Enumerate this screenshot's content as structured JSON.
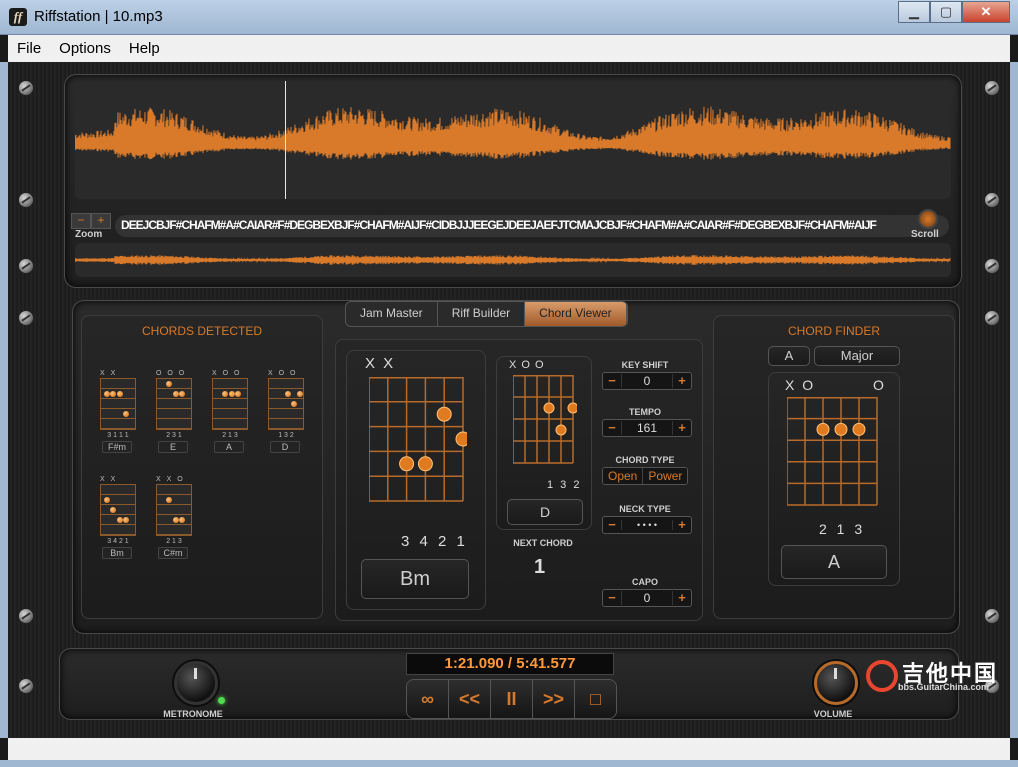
{
  "window": {
    "title": "Riffstation | 10.mp3",
    "app_icon": "ff"
  },
  "menu": [
    "File",
    "Options",
    "Help"
  ],
  "waveform": {
    "chord_sequence_text": "DEEJCBJF#CHAFM#A#CAIAR#F#DEGBEXBJF#CHAFM#AIJF#CIDBJJJEEGEJDEEJAEFJTCMAJCBJF#CHAFM#A#CAIAR#F#DEGBEXBJF#CHAFM#AIJF",
    "zoom_label": "Zoom",
    "zoom_minus": "−",
    "zoom_plus": "+",
    "scroll_label": "Scroll"
  },
  "tabs": [
    "Jam Master",
    "Riff Builder",
    "Chord Viewer"
  ],
  "active_tab": "Chord Viewer",
  "chords_detected": {
    "title": "CHORDS DETECTED",
    "items": [
      {
        "name": "F#m",
        "marks": "X X",
        "fingers": "3 1 1 1"
      },
      {
        "name": "E",
        "marks": "O    O O",
        "fingers": "2 3 1"
      },
      {
        "name": "A",
        "marks": "X O    O",
        "fingers": "2 1 3"
      },
      {
        "name": "D",
        "marks": "X O O",
        "fingers": "1 3 2"
      },
      {
        "name": "Bm",
        "marks": "X X",
        "fingers": "3 4 2 1"
      },
      {
        "name": "C#m",
        "marks": "X X    O",
        "fingers": "2 1 3"
      }
    ]
  },
  "current_chord": {
    "name": "Bm",
    "marks": "X X",
    "fingers": "3 4 2 1"
  },
  "next_chord": {
    "name": "D",
    "marks": "X O O",
    "fingers": "1 3 2",
    "label": "NEXT CHORD",
    "count": "1"
  },
  "controls": {
    "key_shift_label": "KEY SHIFT",
    "key_shift_value": "0",
    "tempo_label": "TEMPO",
    "tempo_value": "161",
    "chord_type_label": "CHORD TYPE",
    "chord_type_options": [
      "Open",
      "Power"
    ],
    "neck_type_label": "NECK TYPE",
    "neck_type_value": "• • • •",
    "capo_label": "CAPO",
    "capo_value": "0",
    "minus": "−",
    "plus": "+"
  },
  "chord_finder": {
    "title": "CHORD FINDER",
    "root": "A",
    "quality": "Major",
    "marks": "X O",
    "marks_right": "O",
    "fingers": "2 1 3",
    "result": "A"
  },
  "transport": {
    "time": "1:21.090 / 5:41.577",
    "metronome_label": "METRONOME",
    "volume_label": "VOLUME",
    "buttons": [
      "∞",
      "<<",
      "II",
      ">>",
      "□"
    ]
  },
  "watermark": {
    "text": "吉他中国",
    "url": "bbs.GuitarChina.com"
  },
  "colors": {
    "accent": "#d97a2a",
    "background": "#1d1d1d",
    "led": "#4fdb4f"
  }
}
